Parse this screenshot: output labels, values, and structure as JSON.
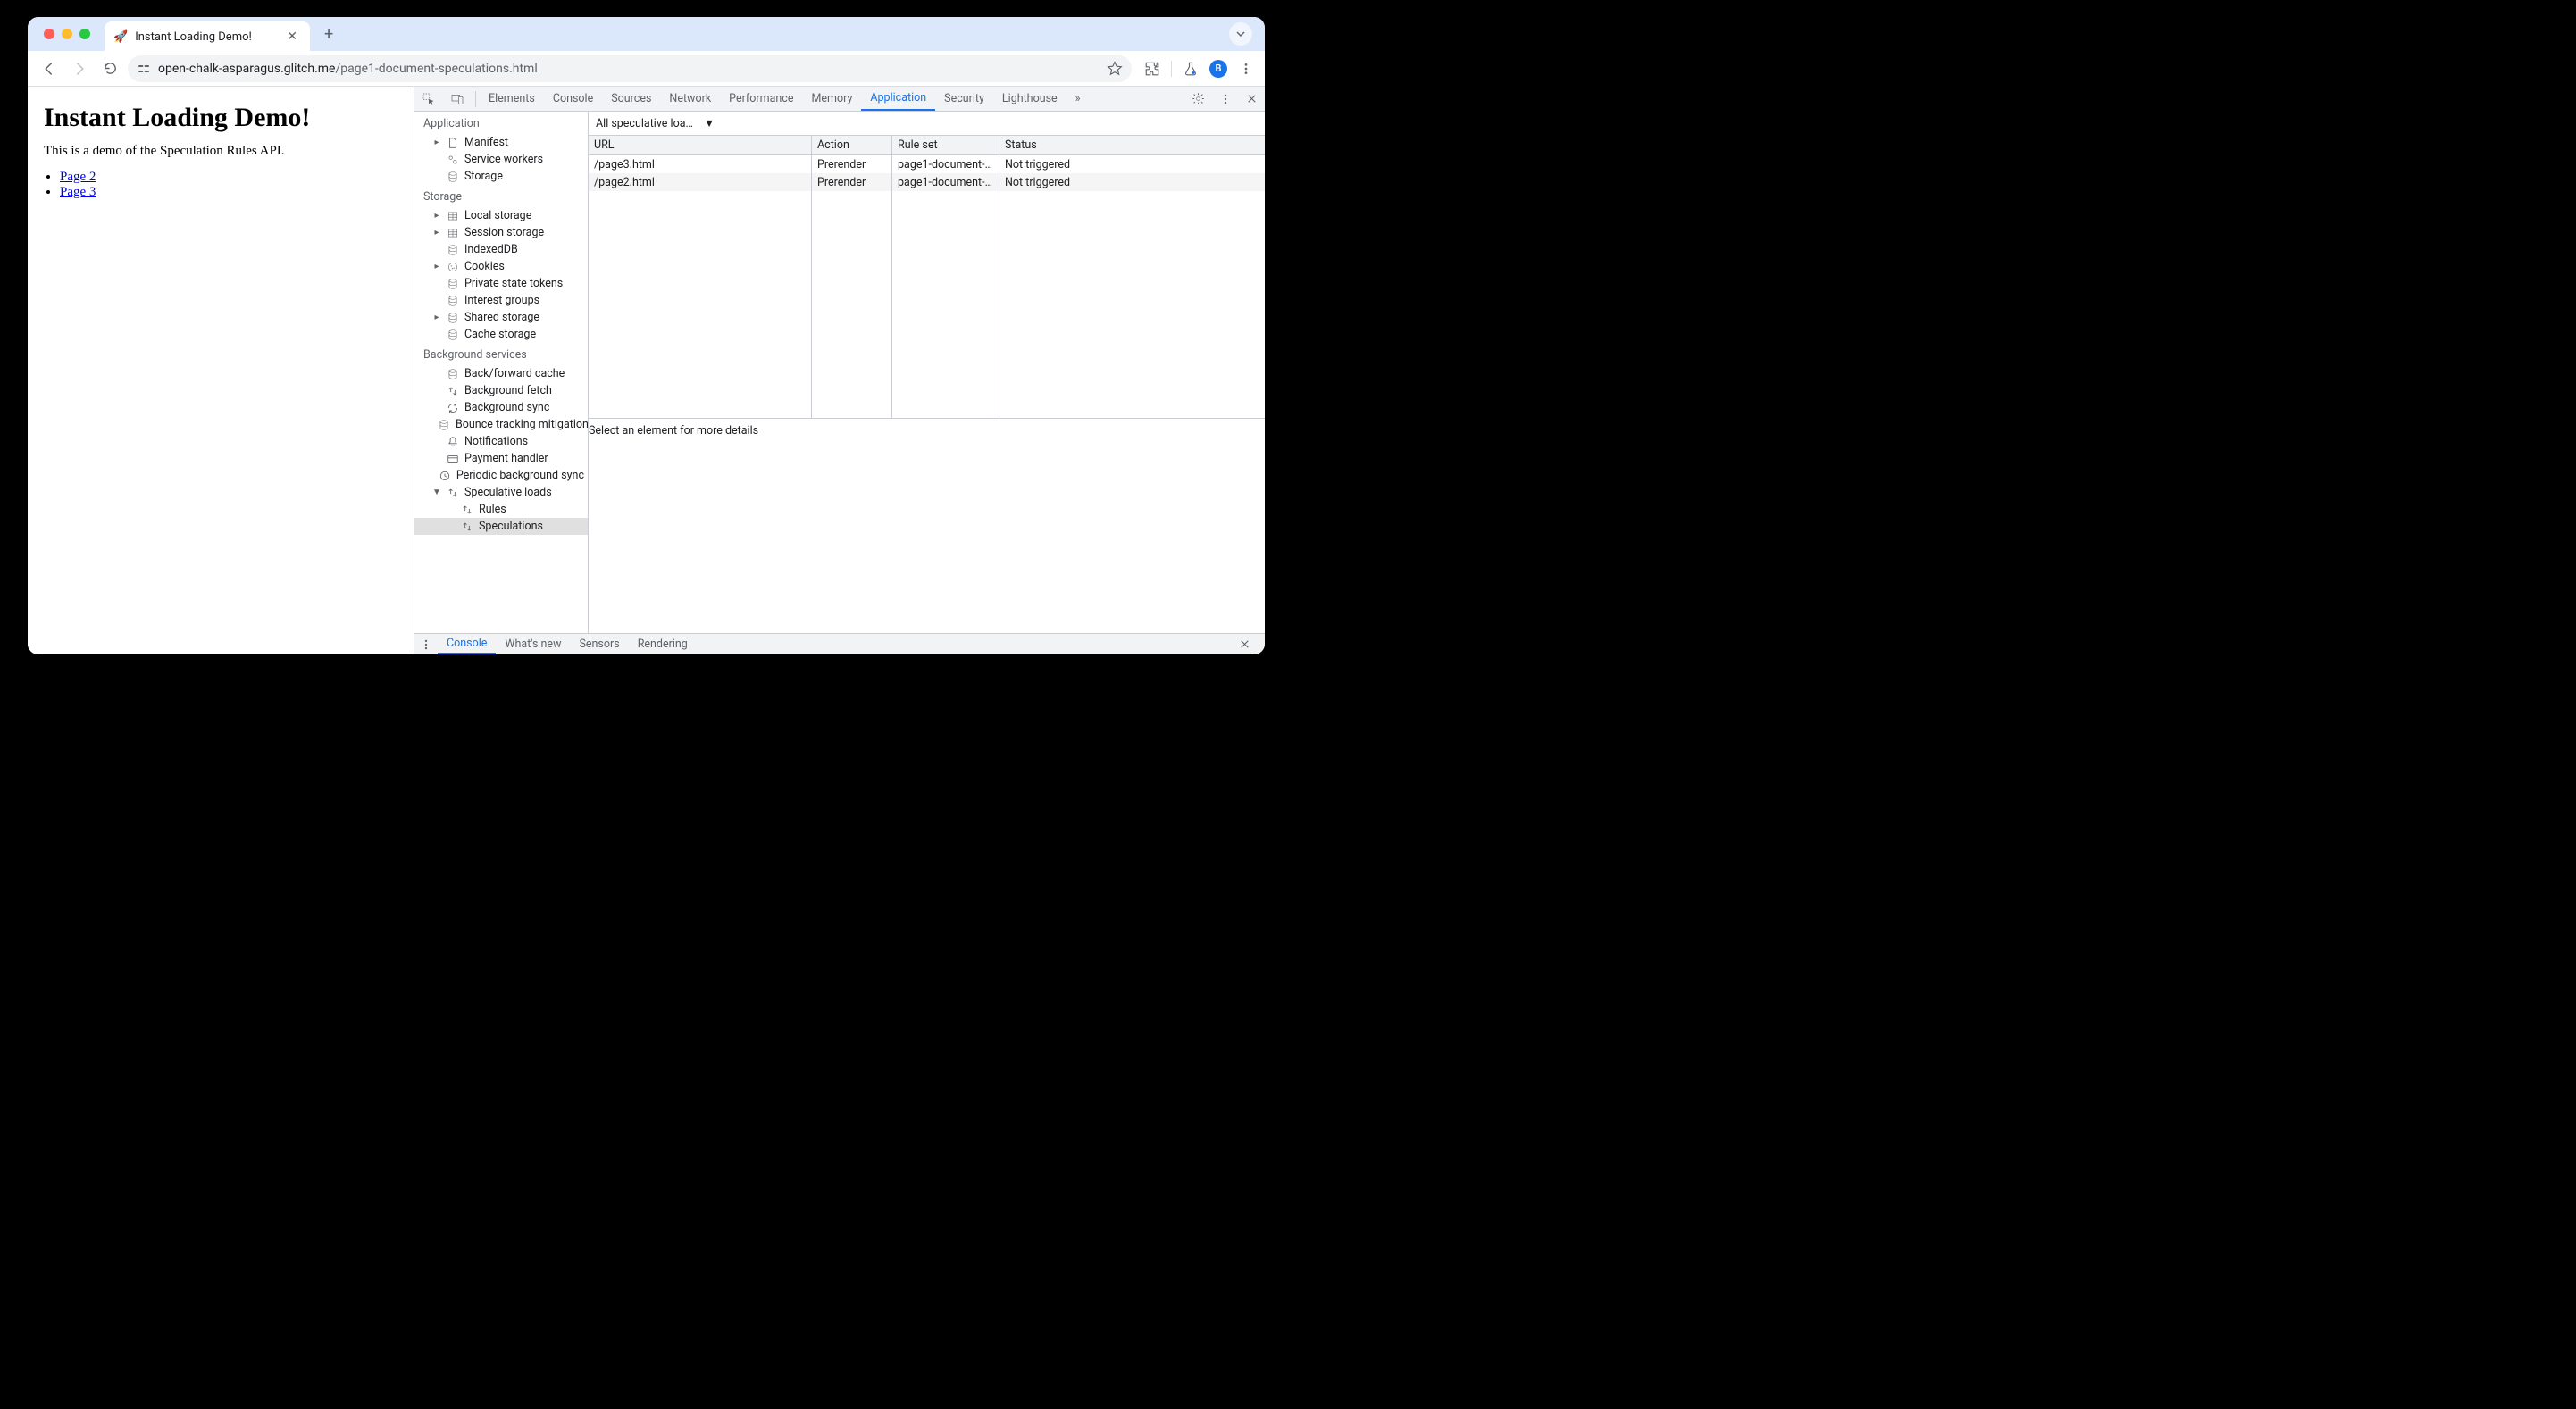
{
  "window": {
    "tab_title": "Instant Loading Demo!",
    "favicon": "🚀"
  },
  "address_bar": {
    "domain": "open-chalk-asparagus.glitch.me",
    "path": "/page1-document-speculations.html",
    "avatar_initial": "B"
  },
  "page": {
    "heading": "Instant Loading Demo!",
    "subtitle": "This is a demo of the Speculation Rules API.",
    "links": [
      {
        "label": "Page 2"
      },
      {
        "label": "Page 3"
      }
    ]
  },
  "devtools": {
    "tabs": [
      "Elements",
      "Console",
      "Sources",
      "Network",
      "Performance",
      "Memory",
      "Application",
      "Security",
      "Lighthouse"
    ],
    "active_tab": "Application",
    "sidebar": {
      "sections": [
        {
          "title": "Application",
          "items": [
            {
              "label": "Manifest",
              "icon": "file",
              "expandable": true
            },
            {
              "label": "Service workers",
              "icon": "gears"
            },
            {
              "label": "Storage",
              "icon": "db"
            }
          ]
        },
        {
          "title": "Storage",
          "items": [
            {
              "label": "Local storage",
              "icon": "table",
              "expandable": true
            },
            {
              "label": "Session storage",
              "icon": "table",
              "expandable": true
            },
            {
              "label": "IndexedDB",
              "icon": "db"
            },
            {
              "label": "Cookies",
              "icon": "cookie",
              "expandable": true
            },
            {
              "label": "Private state tokens",
              "icon": "db"
            },
            {
              "label": "Interest groups",
              "icon": "db"
            },
            {
              "label": "Shared storage",
              "icon": "db",
              "expandable": true
            },
            {
              "label": "Cache storage",
              "icon": "db"
            }
          ]
        },
        {
          "title": "Background services",
          "items": [
            {
              "label": "Back/forward cache",
              "icon": "db"
            },
            {
              "label": "Background fetch",
              "icon": "updown"
            },
            {
              "label": "Background sync",
              "icon": "sync"
            },
            {
              "label": "Bounce tracking mitigation",
              "icon": "db"
            },
            {
              "label": "Notifications",
              "icon": "bell"
            },
            {
              "label": "Payment handler",
              "icon": "card"
            },
            {
              "label": "Periodic background sync",
              "icon": "clock"
            },
            {
              "label": "Speculative loads",
              "icon": "updown",
              "expandable": true,
              "expanded": true,
              "children": [
                {
                  "label": "Rules",
                  "icon": "updown"
                },
                {
                  "label": "Speculations",
                  "icon": "updown",
                  "selected": true
                }
              ]
            }
          ]
        }
      ]
    },
    "main": {
      "dropdown_label": "All speculative loa…",
      "columns": [
        "URL",
        "Action",
        "Rule set",
        "Status"
      ],
      "rows": [
        {
          "url": "/page3.html",
          "action": "Prerender",
          "ruleset": "page1-document-…",
          "status": "Not triggered"
        },
        {
          "url": "/page2.html",
          "action": "Prerender",
          "ruleset": "page1-document-…",
          "status": "Not triggered"
        }
      ],
      "detail_text": "Select an element for more details"
    },
    "drawer": {
      "tabs": [
        "Console",
        "What's new",
        "Sensors",
        "Rendering"
      ],
      "active": "Console"
    }
  }
}
